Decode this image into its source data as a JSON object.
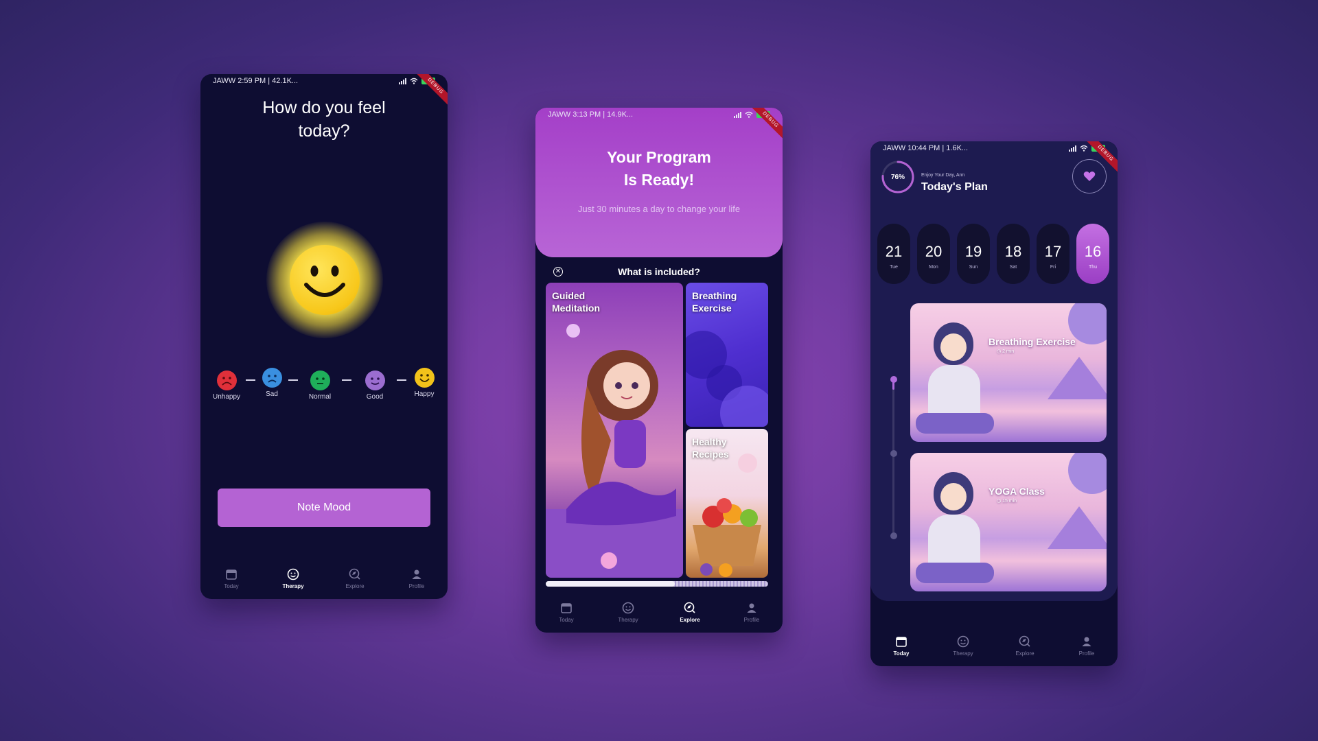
{
  "status_bars": [
    {
      "left": "JAWW  2:59 PM | 42.1K...",
      "battery": "84"
    },
    {
      "left": "JAWW  3:13 PM | 14.9K...",
      "battery": "85"
    },
    {
      "left": "JAWW  10:44 PM | 1.6K...",
      "battery": "63"
    }
  ],
  "debug_label": "DEBUG",
  "mood_screen": {
    "title": "How do you feel\ntoday?",
    "moods": [
      {
        "label": "Unhappy",
        "color": "#e0303a"
      },
      {
        "label": "Sad",
        "color": "#3a8fe0"
      },
      {
        "label": "Normal",
        "color": "#1fae5a"
      },
      {
        "label": "Good",
        "color": "#9b6dd0"
      },
      {
        "label": "Happy",
        "color": "#f2c21a"
      }
    ],
    "button_label": "Note Mood"
  },
  "program_screen": {
    "title": "Your Program\nIs Ready!",
    "subtitle": "Just 30 minutes a day to change your life",
    "included_title": "What is included?",
    "close_glyph": "✕",
    "cards": [
      {
        "label": "Guided\nMeditation"
      },
      {
        "label": "Breathing\nExercise"
      },
      {
        "label": "Healthy\nRecipes"
      }
    ],
    "progress_fraction": 0.58
  },
  "plan_screen": {
    "progress_percent": 76,
    "progress_text": "76%",
    "greeting": "Enjoy Your Day, Ann",
    "title": "Today's Plan",
    "days": [
      {
        "num": "21",
        "name": "Tue",
        "active": false
      },
      {
        "num": "20",
        "name": "Mon",
        "active": false
      },
      {
        "num": "19",
        "name": "Sun",
        "active": false
      },
      {
        "num": "18",
        "name": "Sat",
        "active": false
      },
      {
        "num": "17",
        "name": "Fri",
        "active": false
      },
      {
        "num": "16",
        "name": "Thu",
        "active": true
      }
    ],
    "classes": [
      {
        "name": "Breathing Exercise",
        "duration": "2 min"
      },
      {
        "name": "YOGA Class",
        "duration": "15 min"
      }
    ]
  },
  "nav": {
    "items": [
      {
        "label": "Today",
        "icon": "calendar-icon"
      },
      {
        "label": "Therapy",
        "icon": "smiley-icon"
      },
      {
        "label": "Explore",
        "icon": "explore-icon"
      },
      {
        "label": "Profile",
        "icon": "person-icon"
      }
    ],
    "active_by_screen": [
      "Therapy",
      "Explore",
      "Today"
    ]
  },
  "colors": {
    "accent": "#b463d3",
    "phone_bg": "#0e0d32",
    "panel_bg": "#1d1b50"
  }
}
